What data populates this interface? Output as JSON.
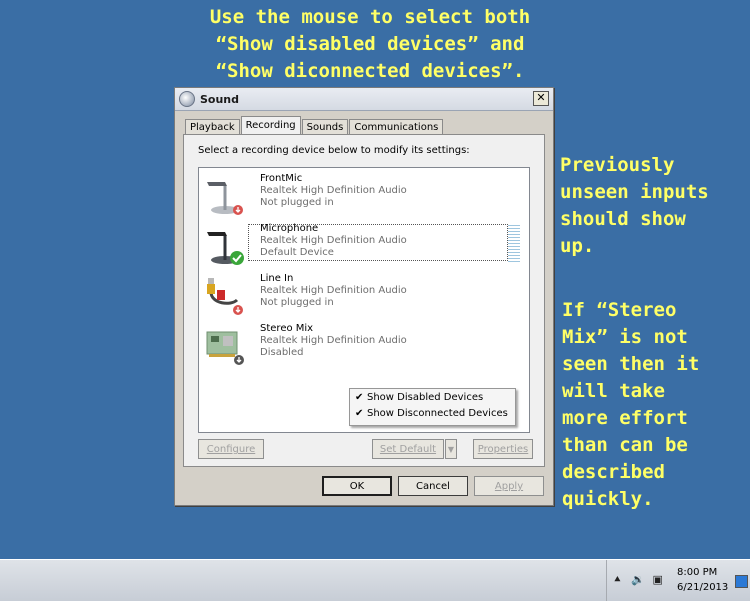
{
  "annotations": {
    "top_line1": "Use the mouse to select both",
    "top_line2": "“Show disabled devices” and",
    "top_line3": "“Show diconnected devices”.",
    "right1": "Previously\nunseen inputs\nshould show\nup.",
    "right2": "If “Stereo\nMix” is not\nseen then it\nwill take\nmore effort\nthan can be\ndescribed\nquickly."
  },
  "dialog": {
    "title": "Sound",
    "close": "✕",
    "tabs": [
      "Playback",
      "Recording",
      "Sounds",
      "Communications"
    ],
    "active_tab": "Recording",
    "instruction": "Select a recording device below to modify its settings:",
    "devices": [
      {
        "name": "FrontMic",
        "driver": "Realtek High Definition Audio",
        "status": "Not plugged in",
        "icon": "microphone-icon",
        "badge": "unplugged"
      },
      {
        "name": "Microphone",
        "driver": "Realtek High Definition Audio",
        "status": "Default Device",
        "icon": "microphone-icon",
        "badge": "default-check"
      },
      {
        "name": "Line In",
        "driver": "Realtek High Definition Audio",
        "status": "Not plugged in",
        "icon": "rca-cable-icon",
        "badge": "unplugged"
      },
      {
        "name": "Stereo Mix",
        "driver": "Realtek High Definition Audio",
        "status": "Disabled",
        "icon": "sound-card-icon",
        "badge": "disabled"
      }
    ],
    "context_menu": [
      {
        "label": "Show Disabled Devices",
        "checked": true
      },
      {
        "label": "Show Disconnected Devices",
        "checked": true
      }
    ],
    "buttons": {
      "configure": "Configure",
      "set_default": "Set Default",
      "properties": "Properties",
      "ok": "OK",
      "cancel": "Cancel",
      "apply": "Apply"
    }
  },
  "taskbar": {
    "time": "8:00 PM",
    "date": "6/21/2013",
    "tray_icons": [
      "show-hidden-icons-icon",
      "speaker-icon",
      "network-icon"
    ]
  },
  "colors": {
    "desktop": "#3a6ea5",
    "annotation_text": "#ffff66",
    "dialog_face": "#d4d0c8"
  }
}
